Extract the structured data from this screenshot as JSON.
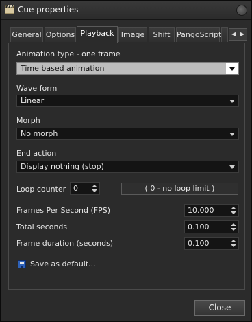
{
  "window": {
    "title": "Cue properties"
  },
  "tabs": [
    {
      "label": "General"
    },
    {
      "label": "Options"
    },
    {
      "label": "Playback"
    },
    {
      "label": "Image"
    },
    {
      "label": "Shift"
    },
    {
      "label": "PangoScript"
    }
  ],
  "active_tab": "Playback",
  "playback": {
    "animation_type": {
      "label": "Animation type - one frame",
      "value": "Time based animation"
    },
    "wave_form": {
      "label": "Wave form",
      "value": "Linear"
    },
    "morph": {
      "label": "Morph",
      "value": "No morph"
    },
    "end_action": {
      "label": "End action",
      "value": "Display nothing (stop)"
    },
    "loop_counter": {
      "label": "Loop counter",
      "value": "0",
      "note": "( 0 - no loop limit )"
    },
    "fps": {
      "label": "Frames Per Second (FPS)",
      "value": "10.000"
    },
    "total_seconds": {
      "label": "Total seconds",
      "value": "0.100"
    },
    "frame_duration": {
      "label": "Frame duration (seconds)",
      "value": "0.100"
    },
    "save_default_label": "Save as default..."
  },
  "footer": {
    "close_label": "Close"
  },
  "icons": {
    "app": "clapperboard-icon",
    "save": "floppy-disk-icon"
  }
}
